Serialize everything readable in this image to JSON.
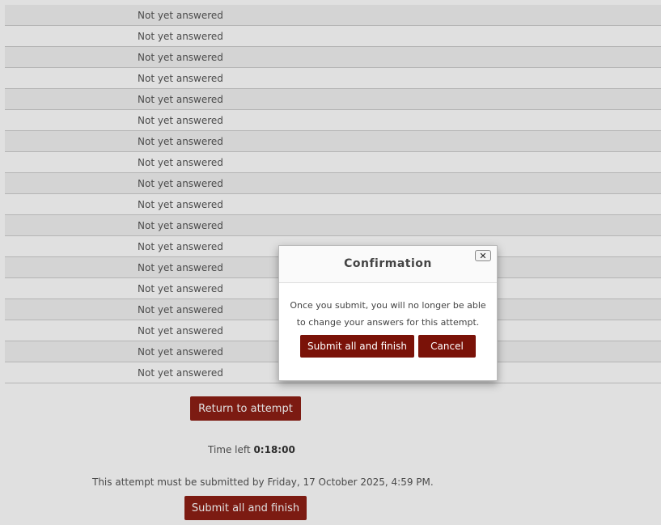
{
  "summary": {
    "rows": [
      "Not yet answered",
      "Not yet answered",
      "Not yet answered",
      "Not yet answered",
      "Not yet answered",
      "Not yet answered",
      "Not yet answered",
      "Not yet answered",
      "Not yet answered",
      "Not yet answered",
      "Not yet answered",
      "Not yet answered",
      "Not yet answered",
      "Not yet answered",
      "Not yet answered",
      "Not yet answered",
      "Not yet answered",
      "Not yet answered"
    ]
  },
  "actions": {
    "return_label": "Return to attempt",
    "time_left_label": "Time left",
    "time_left_value": "0:18:00",
    "deadline_text": "This attempt must be submitted by Friday, 17 October 2025, 4:59 PM.",
    "submit_label": "Submit all and finish"
  },
  "dialog": {
    "title": "Confirmation",
    "close_label": "✕",
    "message_line1": "Once you submit, you will no longer be able",
    "message_line2": "to change your answers for this attempt.",
    "submit_label": "Submit all and finish",
    "cancel_label": "Cancel"
  },
  "colors": {
    "primary": "#8e1f15",
    "dialog_primary": "#7a1208"
  }
}
